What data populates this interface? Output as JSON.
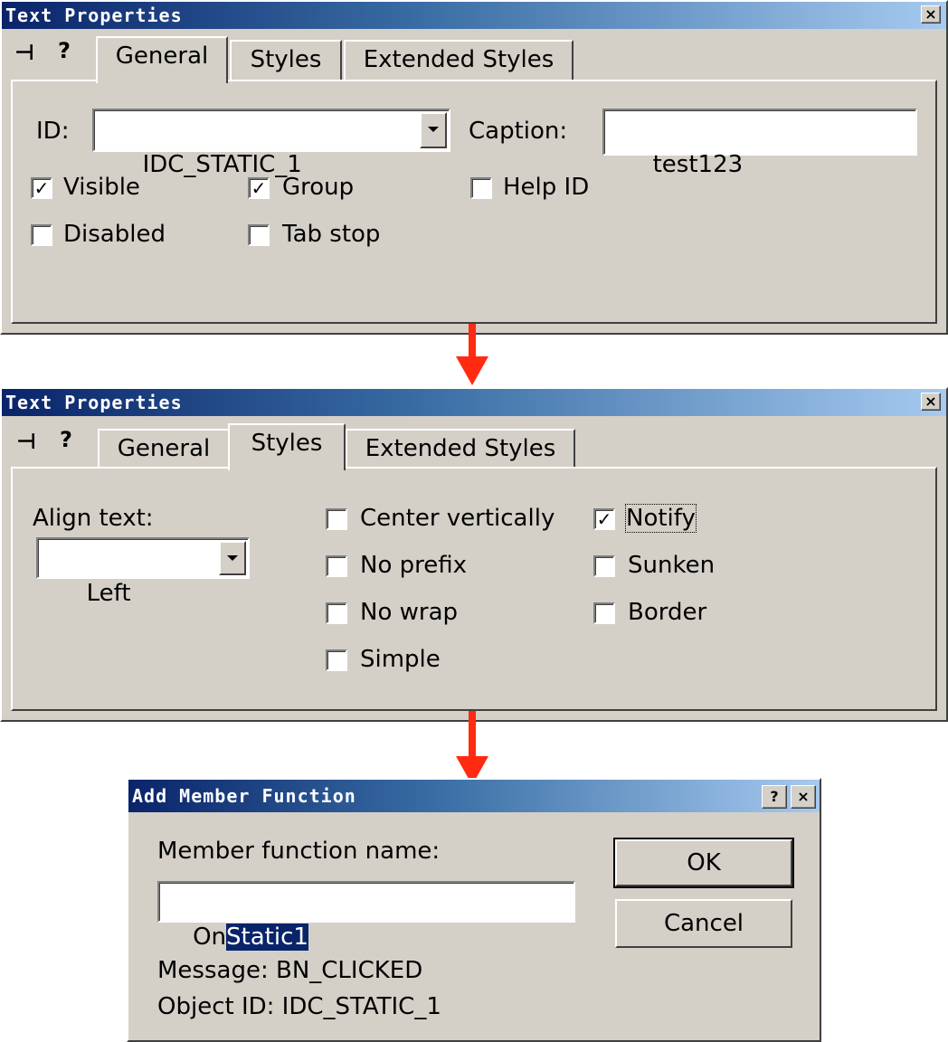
{
  "dialog1": {
    "title": "Text Properties",
    "close_glyph": "×",
    "pin_glyph": "⊣",
    "help_glyph": "?",
    "tabs": [
      "General",
      "Styles",
      "Extended Styles"
    ],
    "active_tab": "General",
    "id_label": "ID:",
    "id_value": "IDC_STATIC_1",
    "caption_label": "Caption:",
    "caption_value": "test123",
    "checkboxes": [
      {
        "label": "Visible",
        "checked": true
      },
      {
        "label": "Group",
        "checked": true
      },
      {
        "label": "Help ID",
        "checked": false
      },
      {
        "label": "Disabled",
        "checked": false
      },
      {
        "label": "Tab stop",
        "checked": false
      }
    ]
  },
  "dialog2": {
    "title": "Text Properties",
    "close_glyph": "×",
    "pin_glyph": "⊣",
    "help_glyph": "?",
    "tabs": [
      "General",
      "Styles",
      "Extended Styles"
    ],
    "active_tab": "Styles",
    "align_label": "Align text:",
    "align_value": "Left",
    "checkboxes": [
      {
        "label": "Center vertically",
        "checked": false
      },
      {
        "label": "No prefix",
        "checked": false
      },
      {
        "label": "No wrap",
        "checked": false
      },
      {
        "label": "Simple",
        "checked": false
      },
      {
        "label": "Notify",
        "checked": true
      },
      {
        "label": "Sunken",
        "checked": false
      },
      {
        "label": "Border",
        "checked": false
      }
    ]
  },
  "dialog3": {
    "title": "Add Member Function",
    "help_glyph": "?",
    "close_glyph": "×",
    "name_label": "Member function name:",
    "name_prefix": "On",
    "name_selected": "Static1",
    "ok_label": "OK",
    "cancel_label": "Cancel",
    "message_text": "Message: BN_CLICKED",
    "object_id_text": "Object ID: IDC_STATIC_1"
  },
  "check_glyph": "✓",
  "colors": {
    "face": "#d4d0c8",
    "title_start": "#0a246a",
    "title_end": "#a6caf0",
    "arrow": "#ff2a10",
    "selection": "#0a246a"
  }
}
